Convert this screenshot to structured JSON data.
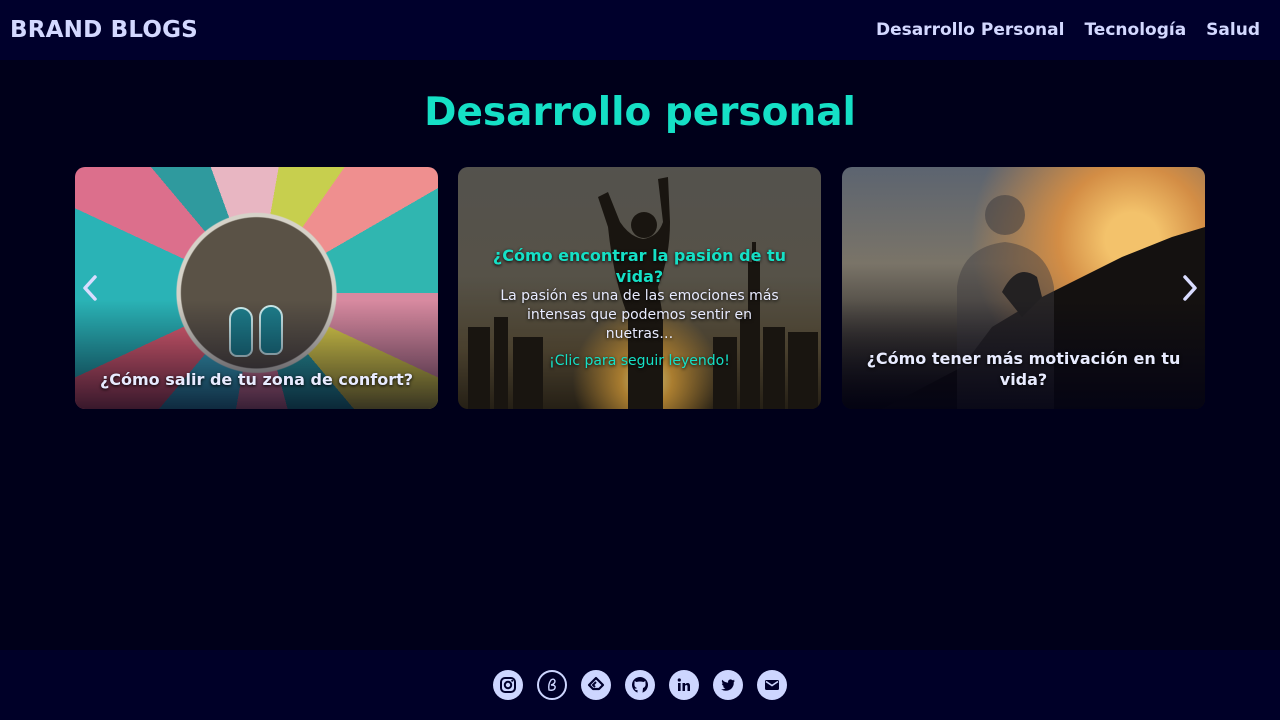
{
  "header": {
    "brand": "BRAND BLOGS",
    "nav": [
      "Desarrollo Personal",
      "Tecnología",
      "Salud"
    ]
  },
  "main": {
    "title": "Desarrollo personal",
    "cards": [
      {
        "title": "¿Cómo salir de tu zona de confort?"
      },
      {
        "title": "¿Cómo encontrar la pasión de tu vida?",
        "excerpt": "La pasión es una de las emociones más intensas que podemos sentir en nuetras…",
        "link_text": "¡Clic para seguir leyendo!"
      },
      {
        "title": "¿Cómo tener más motivación en tu vida?"
      }
    ]
  },
  "footer": {
    "icons": [
      "instagram-icon",
      "blogger-icon",
      "feedly-icon",
      "github-icon",
      "linkedin-icon",
      "twitter-icon",
      "email-icon"
    ]
  },
  "colors": {
    "background": "#00001a",
    "navbar": "#00002c",
    "accent": "#15e0c6",
    "text": "#d3d8ff"
  }
}
